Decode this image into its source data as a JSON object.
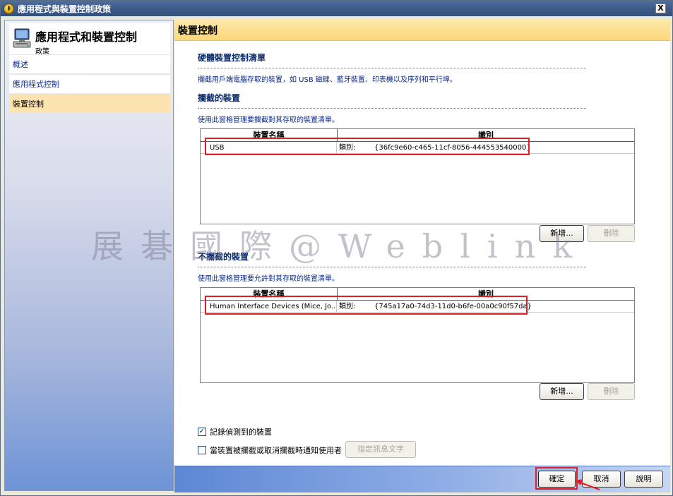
{
  "window": {
    "title": "應用程式與裝置控制政策",
    "close_glyph": "X"
  },
  "sidebar": {
    "title": "應用程式和裝置控制",
    "subtitle": "政策",
    "items": [
      {
        "label": "概述"
      },
      {
        "label": "應用程式控制"
      },
      {
        "label": "裝置控制"
      }
    ]
  },
  "main": {
    "title": "裝置控制",
    "hardware_section": {
      "title": "硬體裝置控制清單",
      "description": "攔截用戶端電腦存取的裝置，如 USB 磁碟、藍牙裝置、印表機以及序列和平行埠。"
    },
    "blocked": {
      "title": "攔截的裝置",
      "description": "使用此窗格管理要攔截對其存取的裝置清單。",
      "columns": [
        "裝置名稱",
        "識別"
      ],
      "rows": [
        {
          "name": "USB",
          "class_label": "類別:",
          "guid": "{36fc9e60-c465-11cf-8056-444553540000}"
        }
      ],
      "add_button": "新增...",
      "delete_button": "刪除"
    },
    "allowed": {
      "title": "不攔截的裝置",
      "description": "使用此窗格管理要允許對其存取的裝置清單。",
      "columns": [
        "裝置名稱",
        "識別"
      ],
      "rows": [
        {
          "name": "Human Interface Devices (Mice, Jo...",
          "class_label": "類別:",
          "guid": "{745a17a0-74d3-11d0-b6fe-00a0c90f57da}"
        }
      ],
      "add_button": "新增...",
      "delete_button": "刪除"
    },
    "options": {
      "log_detected": {
        "label": "記錄偵測到的裝置",
        "checked": true
      },
      "notify_user": {
        "label": "當裝置被攔截或取消攔截時通知使用者",
        "checked": false
      },
      "message_button": "指定訊息文字"
    }
  },
  "footer": {
    "ok": "確定",
    "cancel": "取消",
    "help": "說明"
  },
  "watermark": "展碁國際@Weblink",
  "colors": {
    "highlight_red": "#e01e26",
    "header_gold": "#fbd77a",
    "active_item": "#fde3b0",
    "link_blue": "#0b2a8a"
  }
}
